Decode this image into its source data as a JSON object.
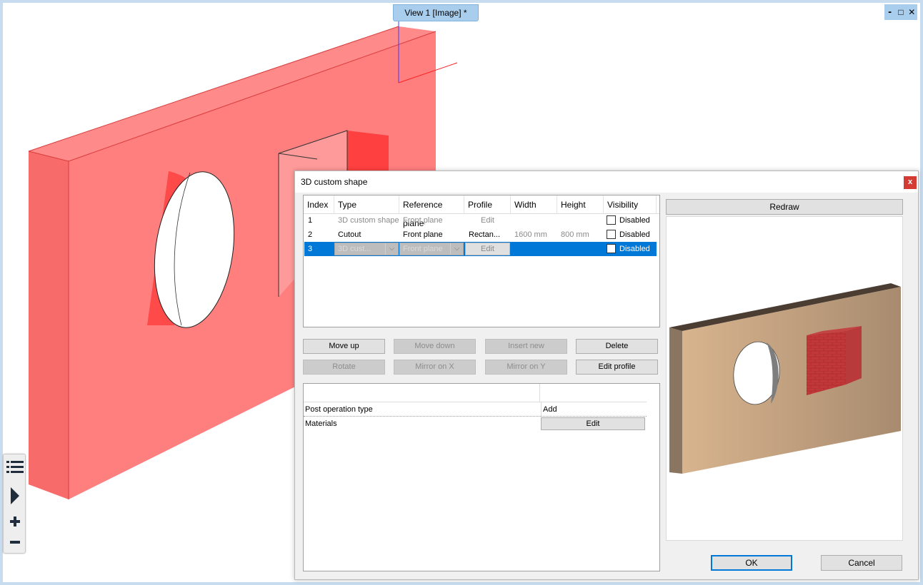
{
  "viewport": {
    "tab_title": "View 1 [Image] *",
    "window_controls": [
      "⁃",
      "□",
      "✕"
    ]
  },
  "side_toolbar": {
    "icons": [
      "list-icon",
      "play-icon",
      "zoom-in-icon",
      "zoom-out-icon"
    ]
  },
  "dialog": {
    "title": "3D custom shape",
    "close_label": "x",
    "table": {
      "columns": [
        "Index",
        "Type",
        "Reference plane",
        "Profile",
        "Width",
        "Height",
        "Visibility"
      ],
      "rows": [
        {
          "index": "1",
          "type": "3D custom shape",
          "reference_plane": "Front plane",
          "profile": "Edit",
          "width": "",
          "height": "",
          "visibility": "Disabled"
        },
        {
          "index": "2",
          "type": "Cutout",
          "reference_plane": "Front plane",
          "profile": "Rectan...",
          "width": "1600 mm",
          "height": "800 mm",
          "visibility": "Disabled"
        },
        {
          "index": "3",
          "type": "3D cust...",
          "reference_plane": "Front plane",
          "profile": "Edit",
          "width": "",
          "height": "",
          "visibility": "Disabled"
        }
      ]
    },
    "buttons": {
      "move_up": "Move up",
      "move_down": "Move down",
      "insert_new": "Insert new",
      "delete": "Delete",
      "rotate": "Rotate",
      "mirror_x": "Mirror on X",
      "mirror_y": "Mirror on Y",
      "edit_profile": "Edit profile"
    },
    "properties": [
      {
        "key": "Post operation type",
        "value": "Add"
      },
      {
        "key": "Materials",
        "value": "Edit"
      }
    ],
    "redraw": "Redraw",
    "ok": "OK",
    "cancel": "Cancel"
  },
  "colors": {
    "accent": "#0078d7",
    "shape_fill": "#ff7f7f",
    "wall_color": "#c9a882",
    "brick_color": "#c43a3a"
  }
}
